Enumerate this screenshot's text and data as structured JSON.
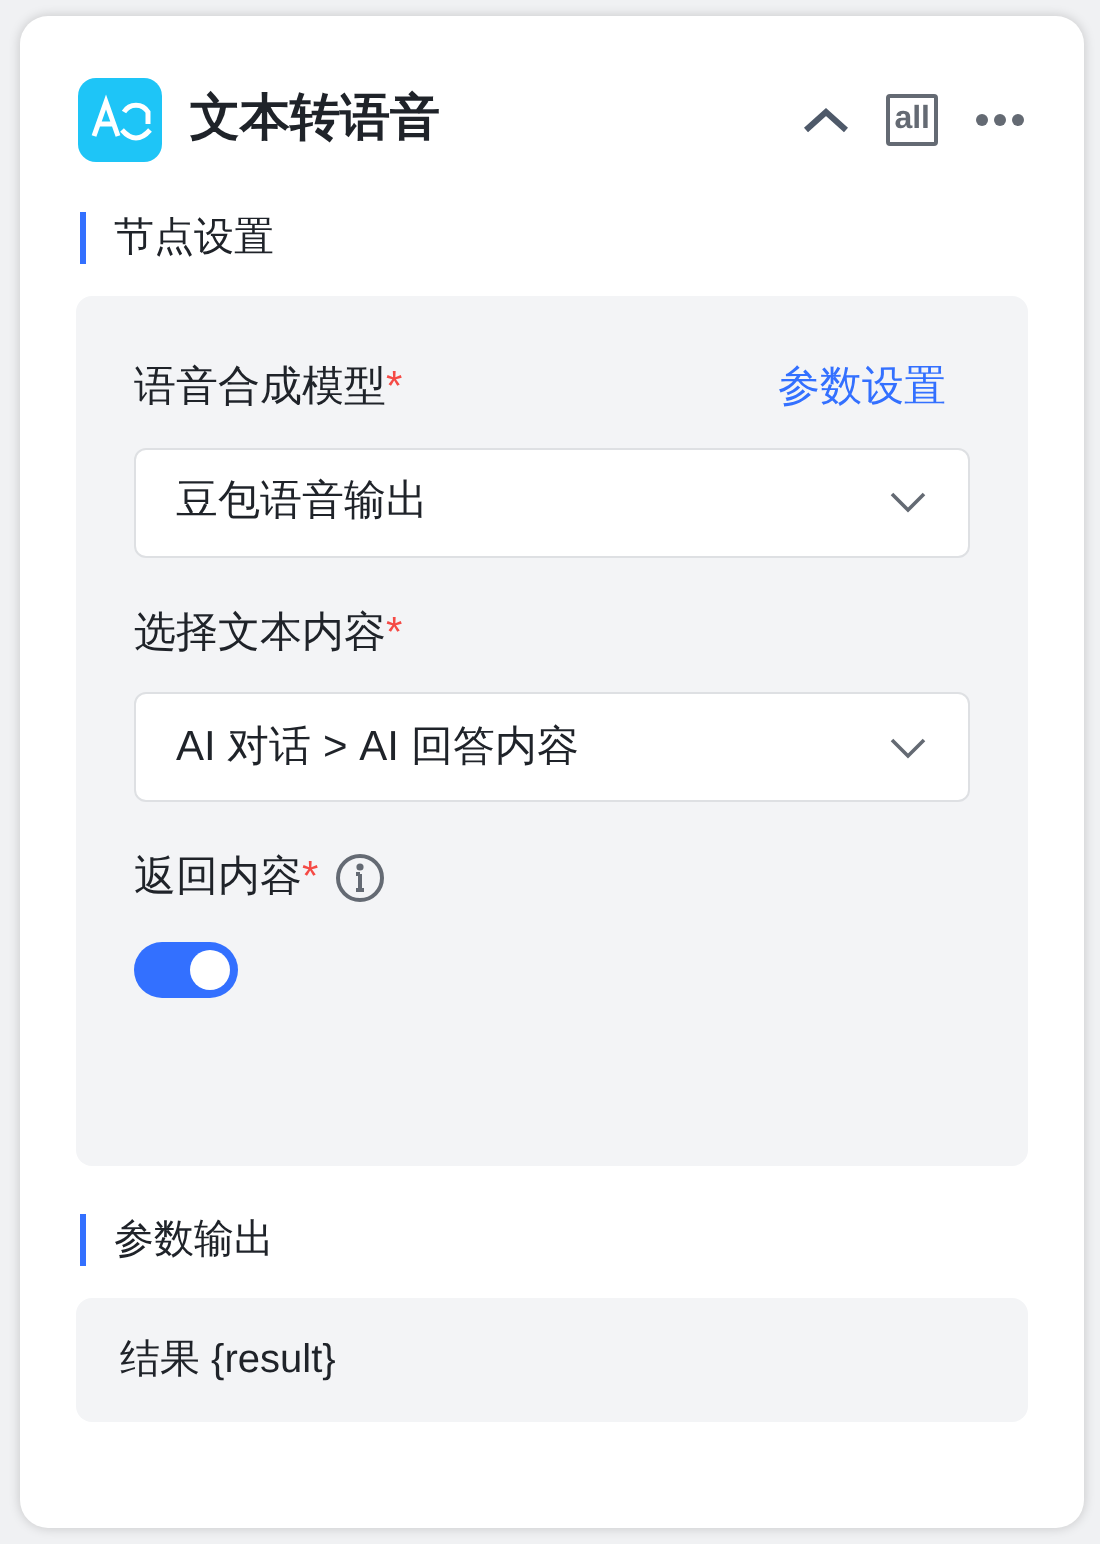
{
  "header": {
    "title": "文本转语音",
    "badge": "all"
  },
  "node_settings": {
    "heading": "节点设置",
    "fields": [
      {
        "kind": "select",
        "label": "语音合成模型",
        "required_mark": "*",
        "link": "参数设置",
        "value": "豆包语音输出"
      },
      {
        "kind": "select",
        "label": "选择文本内容",
        "required_mark": "*",
        "value": "AI 对话 > AI 回答内容"
      },
      {
        "kind": "switch",
        "label": "返回内容",
        "required_mark": "*",
        "info": true,
        "on": true
      }
    ]
  },
  "output": {
    "heading": "参数输出",
    "text": "结果 {result}"
  }
}
